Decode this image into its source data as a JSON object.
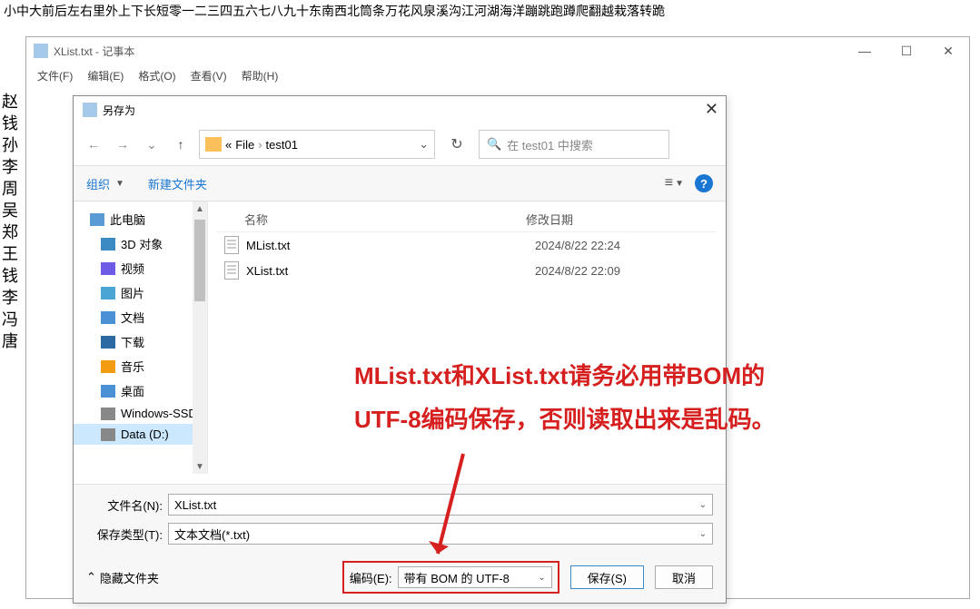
{
  "top_text": "小中大前后左右里外上下长短零一二三四五六七八九十东南西北筒条万花风泉溪沟江河湖海洋蹦跳跑蹲爬翻越栽落转跪",
  "notepad": {
    "title": "XList.txt - 记事本",
    "menu": {
      "file": "文件(F)",
      "edit": "编辑(E)",
      "format": "格式(O)",
      "view": "查看(V)",
      "help": "帮助(H)"
    },
    "window": {
      "minimize": "—",
      "maximize": "☐",
      "close": "✕"
    }
  },
  "left_chars": [
    "赵",
    "钱",
    "孙",
    "李",
    "周",
    "吴",
    "郑",
    "王",
    "钱",
    "李",
    "冯",
    "唐"
  ],
  "saveas": {
    "title": "另存为",
    "close": "✕",
    "breadcrumb": {
      "prefix": "«",
      "part1": "File",
      "sep": "›",
      "part2": "test01"
    },
    "search_placeholder": "在 test01 中搜索",
    "toolbar": {
      "organize": "组织",
      "newfolder": "新建文件夹"
    },
    "tree": [
      {
        "label": "此电脑",
        "icon": "pc"
      },
      {
        "label": "3D 对象",
        "icon": "obj3d"
      },
      {
        "label": "视频",
        "icon": "video"
      },
      {
        "label": "图片",
        "icon": "pic"
      },
      {
        "label": "文档",
        "icon": "doc"
      },
      {
        "label": "下载",
        "icon": "download"
      },
      {
        "label": "音乐",
        "icon": "music"
      },
      {
        "label": "桌面",
        "icon": "desktop"
      },
      {
        "label": "Windows-SSD",
        "icon": "disk"
      },
      {
        "label": "Data (D:)",
        "icon": "disk",
        "selected": true
      }
    ],
    "columns": {
      "name": "名称",
      "date": "修改日期"
    },
    "files": [
      {
        "name": "MList.txt",
        "date": "2024/8/22 22:24"
      },
      {
        "name": "XList.txt",
        "date": "2024/8/22 22:09"
      }
    ],
    "filename_label": "文件名(N):",
    "filename_value": "XList.txt",
    "filetype_label": "保存类型(T):",
    "filetype_value": "文本文档(*.txt)",
    "hide_folders": "隐藏文件夹",
    "encoding_label": "编码(E):",
    "encoding_value": "带有 BOM 的 UTF-8",
    "save_btn": "保存(S)",
    "cancel_btn": "取消"
  },
  "annotation": {
    "line1": "MList.txt和XList.txt请务必用带BOM的",
    "line2": "UTF-8编码保存，否则读取出来是乱码。"
  }
}
